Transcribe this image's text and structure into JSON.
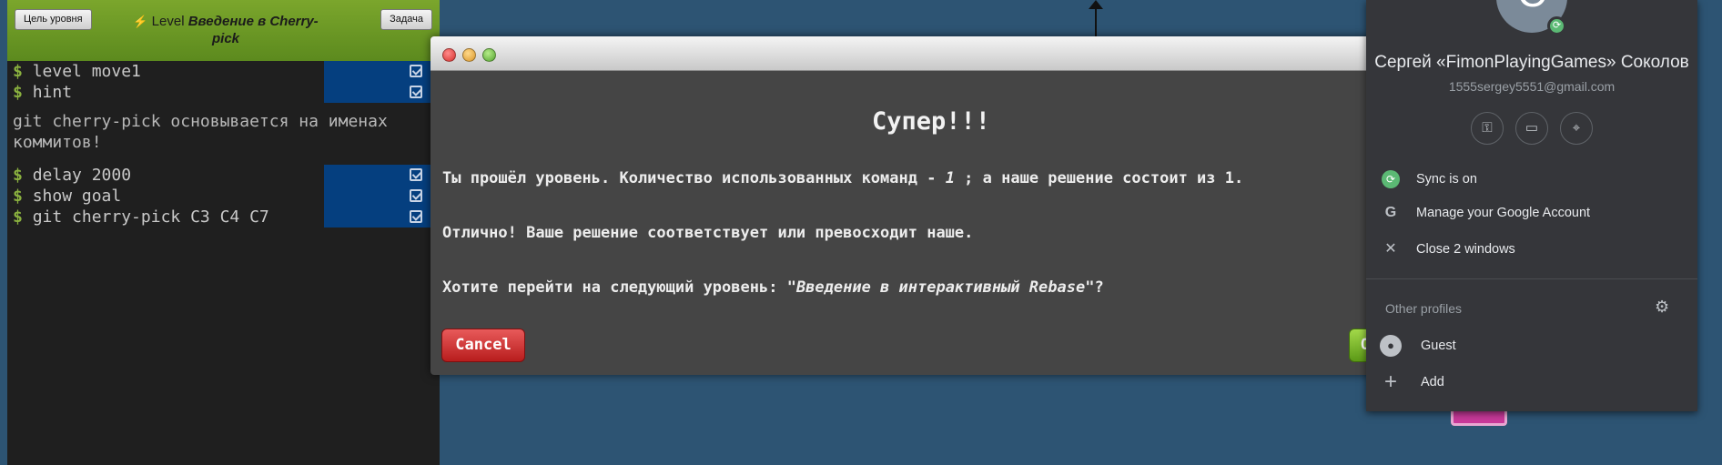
{
  "level_panel": {
    "goal_button": "Цель уровня",
    "task_button": "Задача",
    "title_prefix": "Level",
    "title_name_part1": "Введение в Cherry-",
    "title_name_part2": "pick",
    "bolt_icon": "lightning-icon"
  },
  "terminal": {
    "prompt": "$",
    "commands_top": [
      {
        "text": "level move1",
        "done": true
      },
      {
        "text": "hint",
        "done": true
      }
    ],
    "hint_text": "git cherry-pick основывается на именах коммитов!",
    "commands_bottom": [
      {
        "text": "delay 2000",
        "done": true
      },
      {
        "text": "show goal",
        "done": true
      },
      {
        "text": "git cherry-pick C3 C4 C7",
        "done": true
      }
    ]
  },
  "dialog": {
    "heading": "Супер!!!",
    "line1_before": "Ты прошёл уровень. Количество использованных команд - ",
    "line1_count": "1",
    "line1_after": " ; а наше решение состоит из 1.",
    "line2": "Отлично! Ваше решение соответствует или превосходит наше.",
    "line3_before": "Хотите перейти на следующий уровень: ",
    "line3_level": "\"Введение в интерактивный Rebase\"",
    "line3_after": "?",
    "cancel_label": "Cancel",
    "ok_label": "O"
  },
  "profile_menu": {
    "avatar_letter": "C",
    "name": "Сергей «FimonPlayingGames» Соколов",
    "email": "1555sergey5551@gmail.com",
    "quick_buttons": [
      "key-icon",
      "credit-card-icon",
      "location-pin-icon"
    ],
    "items": {
      "sync": "Sync is on",
      "manage": "Manage your Google Account",
      "close": "Close 2 windows"
    },
    "other_profiles_label": "Other profiles",
    "guest": "Guest",
    "add": "Add"
  },
  "colors": {
    "background": "#2d5473",
    "terminal_bg": "#1f1f1f",
    "header_green": "#6c9a24",
    "command_highlight": "#053f7f",
    "dialog_bg": "#454545",
    "cancel_red": "#d03a3a",
    "ok_green": "#7bbf2e",
    "menu_bg": "#35363a",
    "sync_green": "#5bb974"
  }
}
